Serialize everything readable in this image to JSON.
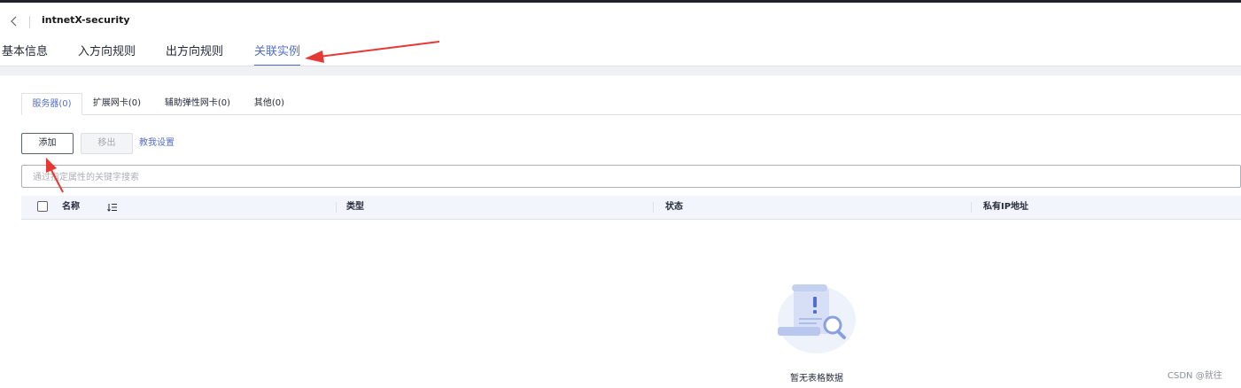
{
  "header": {
    "title": "intnetX-security",
    "tabs": [
      {
        "label": "基本信息",
        "active": false
      },
      {
        "label": "入方向规则",
        "active": false
      },
      {
        "label": "出方向规则",
        "active": false
      },
      {
        "label": "关联实例",
        "active": true
      }
    ]
  },
  "sub_tabs": [
    {
      "label": "服务器(0)",
      "active": true
    },
    {
      "label": "扩展网卡(0)",
      "active": false
    },
    {
      "label": "辅助弹性网卡(0)",
      "active": false
    },
    {
      "label": "其他(0)",
      "active": false
    }
  ],
  "toolbar": {
    "add_label": "添加",
    "remove_label": "移出",
    "settings_link": "教我设置"
  },
  "search": {
    "placeholder": "通过指定属性的关键字搜索",
    "value": ""
  },
  "table": {
    "columns": [
      "名称",
      "类型",
      "状态",
      "私有IP地址"
    ],
    "rows": []
  },
  "empty_state": {
    "text": "暂无表格数据"
  },
  "watermark": "CSDN @就往",
  "colors": {
    "accent": "#526ecc",
    "annotation_arrow": "#e53935",
    "table_header_bg": "#f2f5fc"
  },
  "icons": {
    "back": "chevron-left-icon",
    "sort": "sort-icon",
    "empty": "empty-document-icon"
  }
}
